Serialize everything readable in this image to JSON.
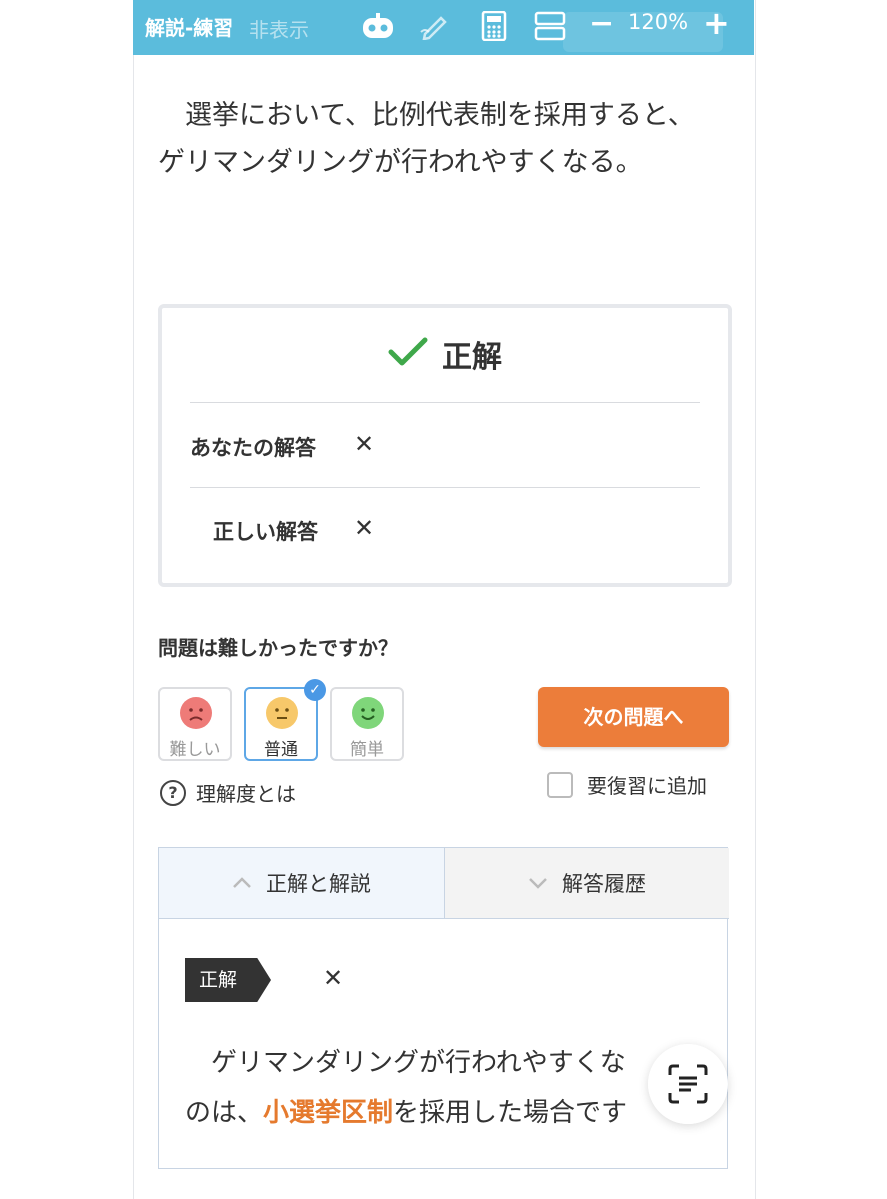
{
  "toolbar": {
    "title": "解説-練習",
    "ghost_label": "非表示",
    "zoom": "120%",
    "minus": "−",
    "plus": "+"
  },
  "question": {
    "text": "選挙において、比例代表制を採用すると、ゲリマンダリングが行われやすくなる。"
  },
  "result": {
    "status": "正解",
    "your_answer_label": "あなたの解答",
    "your_answer_value": "✕",
    "correct_answer_label": "正しい解答",
    "correct_answer_value": "✕"
  },
  "difficulty": {
    "question": "問題は難しかったですか？",
    "options": [
      {
        "label": "難しい",
        "color": "#ee7b78"
      },
      {
        "label": "普通",
        "color": "#f7c86a",
        "selected": true
      },
      {
        "label": "簡単",
        "color": "#7fd67a"
      }
    ],
    "help_label": "理解度とは"
  },
  "actions": {
    "next_label": "次の問題へ",
    "review_label": "要復習に追加"
  },
  "tabs": {
    "active_label": "正解と解説",
    "inactive_label": "解答履歴"
  },
  "explanation": {
    "tag": "正解",
    "answer": "✕",
    "line1": "ゲリマンダリングが行われやすくな",
    "line2_pre": "のは、",
    "line2_highlight": "小選挙区制",
    "line2_post": "を採用した場合です"
  },
  "colors": {
    "toolbar": "#5bbcdc",
    "accent_orange": "#ec7d3a",
    "check_green": "#3fa84a",
    "highlight": "#e57a2e"
  }
}
